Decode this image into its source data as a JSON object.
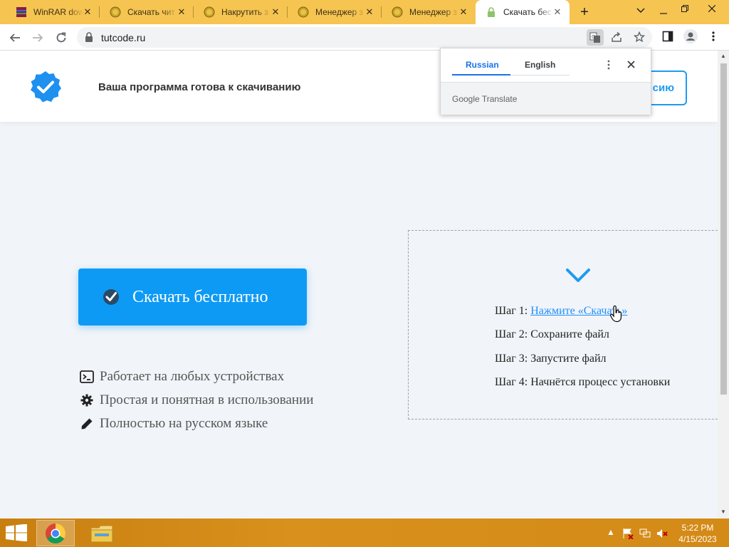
{
  "browser": {
    "tabs": [
      {
        "title": "WinRAR dow",
        "favicon": "winrar-icon",
        "active": false
      },
      {
        "title": "Скачать чит",
        "favicon": "coin-icon",
        "active": false
      },
      {
        "title": "Накрутить з",
        "favicon": "coin-icon",
        "active": false
      },
      {
        "title": "Менеджер з",
        "favicon": "coin-icon",
        "active": false
      },
      {
        "title": "Менеджер з",
        "favicon": "coin-icon",
        "active": false
      },
      {
        "title": "Скачать бес",
        "favicon": "lock-icon",
        "active": true
      }
    ],
    "url": "tutcode.ru"
  },
  "translate_popup": {
    "lang_active": "Russian",
    "lang_other": "English",
    "google": "Google",
    "translate": "Translate"
  },
  "page": {
    "header_title": "Ваша программа готова к скачиванию",
    "header_button_partial": "сию",
    "download_button": "Скачать бесплатно",
    "features": [
      "Работает на любых устройствах",
      "Простая и понятная в использовании",
      "Полностью на русском языке"
    ],
    "steps": [
      {
        "prefix": "Шаг 1: ",
        "text": "Нажмите «Скачать»"
      },
      {
        "prefix": "Шаг 2: ",
        "text": "Сохраните файл"
      },
      {
        "prefix": "Шаг 3: ",
        "text": "Запустите файл"
      },
      {
        "prefix": "Шаг 4: ",
        "text": "Начнётся процесс установки"
      }
    ],
    "accent_color": "#0d9af5"
  },
  "taskbar": {
    "time": "5:22 PM",
    "date": "4/15/2023"
  }
}
